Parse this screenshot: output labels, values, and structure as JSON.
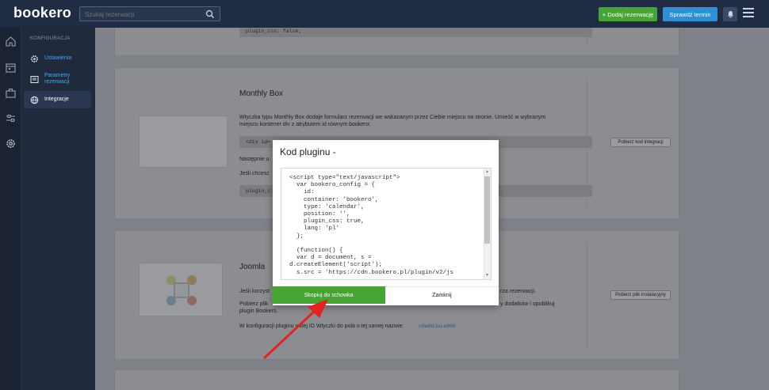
{
  "app": {
    "logo": "bookero",
    "search_placeholder": "Szukaj rezerwacji",
    "add_booking": "+ Dodaj rezerwację",
    "check_date": "Sprawdź termin"
  },
  "submenu": {
    "title": "KONFIGURACJA",
    "items": [
      {
        "label": "Ustawienia"
      },
      {
        "label": "Parametry rezerwacji"
      },
      {
        "label": "Integracje"
      }
    ]
  },
  "cards": {
    "top_code": "plugin_css: false;",
    "monthly": {
      "title": "Monthly Box",
      "desc1": "Wtyczka typu Monthly Box dodaje formularz rezerwacji we wskazanym przez Ciebie miejscu na stronie. Umieść w wybranym",
      "desc2": "miejscu kontener div z atrybutem id równym bookero:",
      "code": "<div id=",
      "next": "Następnie u",
      "ifwant": "Jeśli chcesz",
      "plugin_code": "plugin_c",
      "button": "Pobierz kod integracji"
    },
    "joomla": {
      "title": "Joomla",
      "line1": "Jeśli korzyst",
      "line1_end": "rza rezerwacji.",
      "line2": "Pobierz plik",
      "line2_end": "y dodatków i opublikuj",
      "line3": "plugin Bookero.",
      "line4": "W konfiguracji pluginu wklej ID Wtyczki do pola o tej samej nazwie:",
      "plugin_id": "c0w9dJuLe800",
      "button": "Pobierz plik instalacyjny"
    }
  },
  "modal": {
    "title": "Kod pluginu -",
    "code": "<script type=\"text/javascript\">\n  var bookero_config = {\n    id:\n    container: 'bookero',\n    type: 'calendar',\n    position: '',\n    plugin_css: true,\n    lang: 'pl'\n  };\n\n  (function() {\n  var d = document, s =\nd.createElement('script');\n  s.src = 'https://cdn.bookero.pl/plugin/v2/js",
    "copy_button": "Skopiuj do schowka",
    "close_button": "Zamknij"
  },
  "colors": {
    "green": "#45a432",
    "blue": "#2f8fd4",
    "arrow": "#e32222"
  }
}
